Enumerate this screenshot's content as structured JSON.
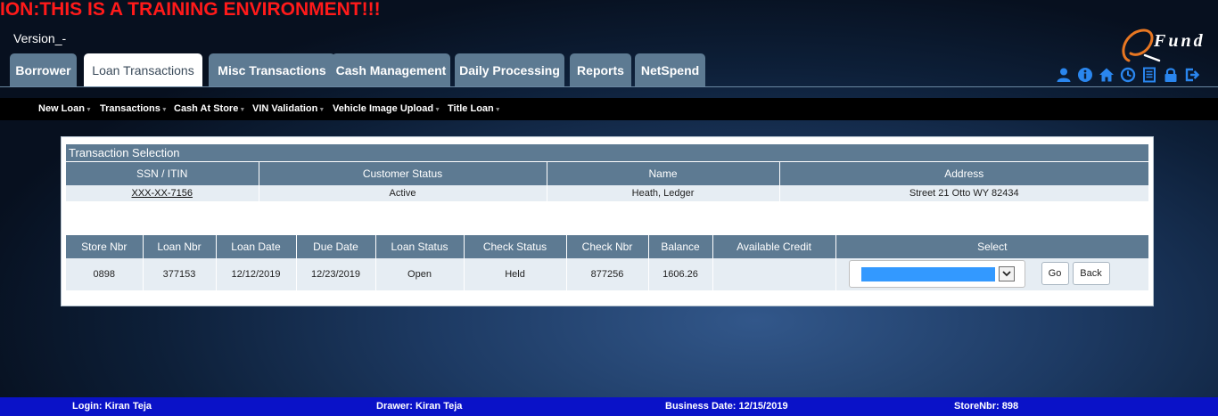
{
  "banner": "ION:THIS IS A TRAINING ENVIRONMENT!!!",
  "version": "Version_-",
  "logo_text": "Fund",
  "tabs": [
    {
      "label": "Borrower",
      "active": false
    },
    {
      "label": "Loan Transactions",
      "active": true
    },
    {
      "label": "Misc Transactions",
      "active": false
    },
    {
      "label": "Cash Management",
      "active": false
    },
    {
      "label": "Daily Processing",
      "active": false
    },
    {
      "label": "Reports",
      "active": false
    },
    {
      "label": "NetSpend",
      "active": false
    }
  ],
  "header_icons": [
    "user-icon",
    "info-icon",
    "home-icon",
    "clock-icon",
    "document-icon",
    "lock-icon",
    "logout-icon"
  ],
  "subnav": [
    "New Loan",
    "Transactions",
    "Cash At Store",
    "VIN Validation",
    "Vehicle Image Upload",
    "Title Loan"
  ],
  "panel": {
    "title": "Transaction Selection",
    "customer_headers": [
      "SSN / ITIN",
      "Customer Status",
      "Name",
      "Address"
    ],
    "customer_row": {
      "ssn": "XXX-XX-7156",
      "status": "Active",
      "name": "Heath,  Ledger",
      "address": "Street 21 Otto WY 82434"
    },
    "loan_headers": [
      "Store Nbr",
      "Loan Nbr",
      "Loan Date",
      "Due Date",
      "Loan Status",
      "Check Status",
      "Check Nbr",
      "Balance",
      "Available Credit",
      "Select"
    ],
    "loan_row": {
      "store_nbr": "0898",
      "loan_nbr": "377153",
      "loan_date": "12/12/2019",
      "due_date": "12/23/2019",
      "loan_status": "Open",
      "check_status": "Held",
      "check_nbr": "877256",
      "balance": "1606.26",
      "available_credit": "",
      "select_value": ""
    },
    "go_label": "Go",
    "back_label": "Back"
  },
  "footer": {
    "login": "Login: Kiran Teja",
    "drawer": "Drawer: Kiran Teja",
    "business_date": "Business Date: 12/15/2019",
    "store": "StoreNbr: 898"
  },
  "colors": {
    "banner": "#ff1a1a",
    "tab": "#5d7a92",
    "header_icon": "#2a86ee",
    "footer": "#0a12c8",
    "select_highlight": "#3399ff",
    "logo_accent": "#e87722"
  }
}
